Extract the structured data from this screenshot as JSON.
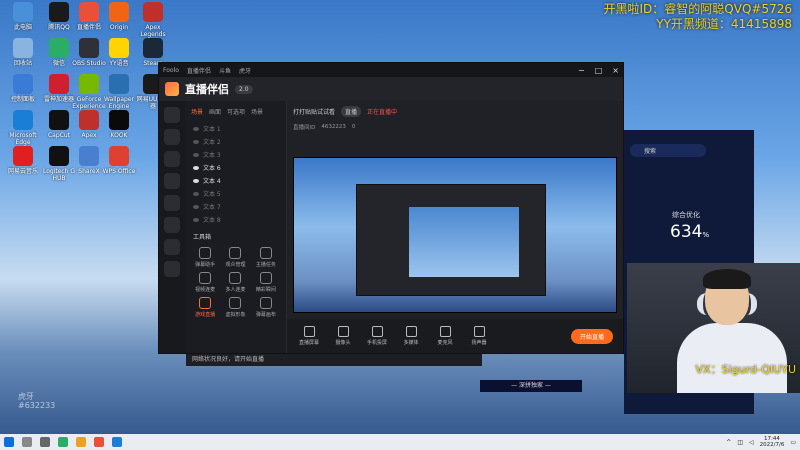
{
  "desktop": {
    "icons": [
      {
        "label": "此电脑",
        "color": "#4a90d9"
      },
      {
        "label": "腾讯QQ",
        "color": "#1a1a1a"
      },
      {
        "label": "直播伴侣",
        "color": "#e8503a"
      },
      {
        "label": "Origin",
        "color": "#f06414"
      },
      {
        "label": "Apex Legends",
        "color": "#c0302a"
      },
      {
        "label": "回收站",
        "color": "#8ab4e0"
      },
      {
        "label": "微信",
        "color": "#2aae67"
      },
      {
        "label": "OBS Studio",
        "color": "#303038"
      },
      {
        "label": "YY语音",
        "color": "#ffd400"
      },
      {
        "label": "Steam",
        "color": "#1b2838"
      },
      {
        "label": "控制面板",
        "color": "#3a7bd5"
      },
      {
        "label": "雷神加速器",
        "color": "#d02030"
      },
      {
        "label": "GeForce Experience",
        "color": "#76b900"
      },
      {
        "label": "Wallpaper Engine",
        "color": "#2a6fb0"
      },
      {
        "label": "网易UU加速器",
        "color": "#1a1a1a"
      },
      {
        "label": "Microsoft Edge",
        "color": "#1a7ed6"
      },
      {
        "label": "CapCut",
        "color": "#111111"
      },
      {
        "label": "Apex",
        "color": "#c0302a"
      },
      {
        "label": "KOOK",
        "color": "#0a0a0a"
      },
      {
        "label": "网易云音乐",
        "color": "#e02020"
      },
      {
        "label": "Logitech G HUB",
        "color": "#111111"
      },
      {
        "label": "ShareX",
        "color": "#4a7fd0"
      },
      {
        "label": "WPS Office",
        "color": "#e04030"
      }
    ]
  },
  "overlay": {
    "line1": "开黑啦ID：睿智的阿聪QVQ#5726",
    "line2": "YY开黑频道：41415898",
    "webcam_tag": "VX：Sigurd-QIUYU",
    "banner": "— 深拼独家 —",
    "watermark_line1": "虎牙",
    "watermark_line2": "#632233"
  },
  "window": {
    "titlebar_items": [
      "Foolo",
      "直播伴侣",
      "斗鱼",
      "虎牙"
    ],
    "app_title": "直播伴侣",
    "version_pill": "2.0",
    "live_title": "打打贴贴试试看",
    "live_tag": "直播",
    "live_status": "正在直播中",
    "room_label": "直播间ID",
    "room_id": "4632223",
    "fans_count": "0",
    "scene_tabs": [
      {
        "label": "场景",
        "active": true
      },
      {
        "label": "画面"
      },
      {
        "label": "可选项"
      },
      {
        "label": "场景"
      }
    ],
    "scenes": [
      {
        "label": "文本 1",
        "on": false
      },
      {
        "label": "文本 2",
        "on": false
      },
      {
        "label": "文本 3",
        "on": false
      },
      {
        "label": "文本 6",
        "on": true
      },
      {
        "label": "文本 4",
        "on": true
      },
      {
        "label": "文本 5",
        "on": false
      },
      {
        "label": "文本 7",
        "on": false
      },
      {
        "label": "文本 8",
        "on": false
      }
    ],
    "tools_title": "工具箱",
    "tools": [
      {
        "label": "弹幕助手",
        "hot": false
      },
      {
        "label": "观众管理",
        "hot": false
      },
      {
        "label": "主播任务",
        "hot": false
      },
      {
        "label": "视频连麦",
        "hot": false
      },
      {
        "label": "多人连麦",
        "hot": false
      },
      {
        "label": "精彩瞬间",
        "hot": false
      },
      {
        "label": "游戏直播",
        "hot": true
      },
      {
        "label": "虚拟形象",
        "hot": false
      },
      {
        "label": "弹幕画布",
        "hot": false
      }
    ],
    "bottom_tools": [
      "直播屏幕",
      "摄像头",
      "手机投屏",
      "多媒体",
      "麦克风",
      "扬声器"
    ],
    "start_button": "开始直播",
    "status_bar": "网络状况良好，请开始直播"
  },
  "right_panel": {
    "search_placeholder": "搜索",
    "opt_label": "综合优化",
    "opt_value": "634",
    "opt_unit": "%"
  },
  "taskbar": {
    "time": "17:44",
    "date": "2022/7/6"
  },
  "colors": {
    "accent": "#ff6a1d",
    "overlay_yellow": "#f0d020"
  }
}
